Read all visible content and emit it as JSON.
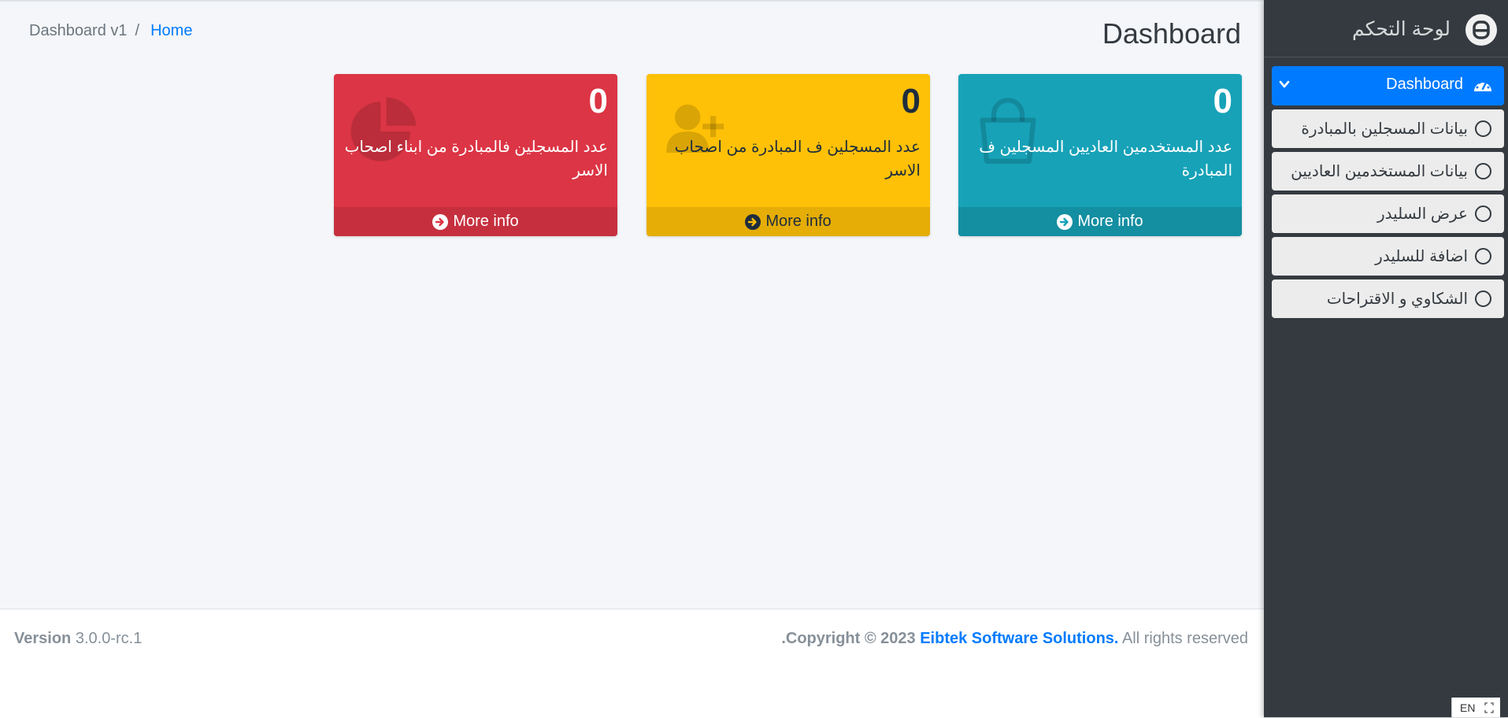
{
  "breadcrumb": {
    "current": "Dashboard v1",
    "separator": "/",
    "home": "Home"
  },
  "page_title": "Dashboard",
  "boxes": [
    {
      "count": "0",
      "description": "عدد المسجلين فالمبادرة من ابناء اصحاب الاسر",
      "more": "More info",
      "icon": "pie-chart-icon",
      "color": "#dc3545"
    },
    {
      "count": "0",
      "description": "عدد المسجلين ف المبادرة من اصحاب الاسر",
      "more": "More info",
      "icon": "user-plus-icon",
      "color": "#ffc107"
    },
    {
      "count": "0",
      "description": "عدد المستخدمين العاديين المسجلين ف المبادرة",
      "more": "More info",
      "icon": "shopping-bag-icon",
      "color": "#17a2b8"
    }
  ],
  "footer": {
    "version_label": "Version",
    "version_value": "3.0.0-rc.1",
    "copyright_prefix": "Copyright © 2023",
    "company": "Eibtek Software Solutions.",
    "rights": "All rights reserved",
    "trailing": "."
  },
  "sidebar": {
    "brand": "لوحة التحكم",
    "active_item": "Dashboard",
    "items": [
      {
        "label": "بيانات المسجلين بالمبادرة"
      },
      {
        "label": "بيانات المستخدمين العاديين"
      },
      {
        "label": "عرض السليدر"
      },
      {
        "label": "اضافة للسليدر"
      },
      {
        "label": "الشكاوي و الاقتراحات"
      }
    ]
  },
  "lang_indicator": "EN",
  "colors": {
    "accent": "#007bff",
    "sidebar": "#343a40",
    "content_bg": "#f4f6f9"
  }
}
